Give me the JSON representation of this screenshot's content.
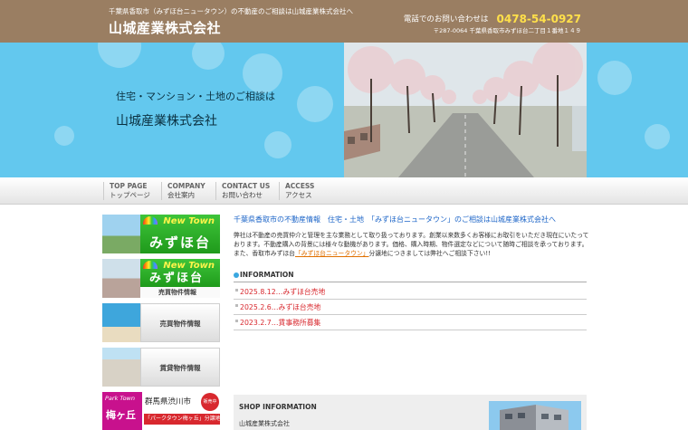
{
  "header": {
    "tagline": "千葉県香取市（みずほ台ニュータウン）の不動産のご相談は山城産業株式会社へ",
    "company": "山城産業株式会社",
    "phone_label": "電話でのお問い合わせは",
    "phone_number": "0478-54-0927",
    "address": "〒287-0064 千葉県香取市みずほ台二丁目１番地１４９"
  },
  "hero": {
    "line1": "住宅・マンション・土地のご相談は",
    "line2": "山城産業株式会社"
  },
  "nav": {
    "items": [
      {
        "en": "TOP PAGE",
        "jp": "トップページ"
      },
      {
        "en": "COMPANY",
        "jp": "会社案内"
      },
      {
        "en": "CONTACT US",
        "jp": "お問い合わせ"
      },
      {
        "en": "ACCESS",
        "jp": "アクセス"
      }
    ]
  },
  "sidebar": {
    "newtown1": {
      "en": "New Town",
      "jp": "みずほ台"
    },
    "newtown2": {
      "en": "New Town",
      "jp": "みずほ台",
      "sub": "売買物件情報"
    },
    "sale_label": "売買物件情報",
    "rent_label": "賃貸物件情報",
    "park": {
      "en": "Park Town",
      "jp": "梅ヶ丘",
      "city": "群馬県渋川市",
      "badge": "販売中",
      "caption": "「パークタウン梅ヶ丘」分譲地"
    }
  },
  "main": {
    "title": "千葉県香取市の不動産情報　住宅・土地　「みずほ台ニュータウン」のご相談は山城産業株式会社へ",
    "body": [
      "弊社は不動産の売買仲介と管理を主な業務として取り扱っております。創業以来数多くお客様にお取引をいただき現在にいたって",
      "おります。不動産購入の背景には様々な動機があります。価格、購入時期、物件選定などについて随時ご相談を承っております。",
      "また、香取市みずほ台"
    ],
    "body_highlight": "「みずほ台ニュータウン」",
    "body_tail": "分譲地につきましては弊社へご相談下さい!!",
    "info_heading": "INFORMATION",
    "news": [
      "2025.8.12…みずほ台売地",
      "2025.2.6…みずほ台売地",
      "2023.2.7…賃事務所募集"
    ],
    "shop_heading": "SHOP INFORMATION",
    "shop_name": "山城産業株式会社"
  },
  "colors": {
    "header_bg": "#9a7e62",
    "hero_bg": "#63c8ee",
    "phone": "#ffe04a",
    "link_blue": "#1e66c8",
    "news_red": "#d8282e",
    "newtown_green": "#2cae28"
  }
}
